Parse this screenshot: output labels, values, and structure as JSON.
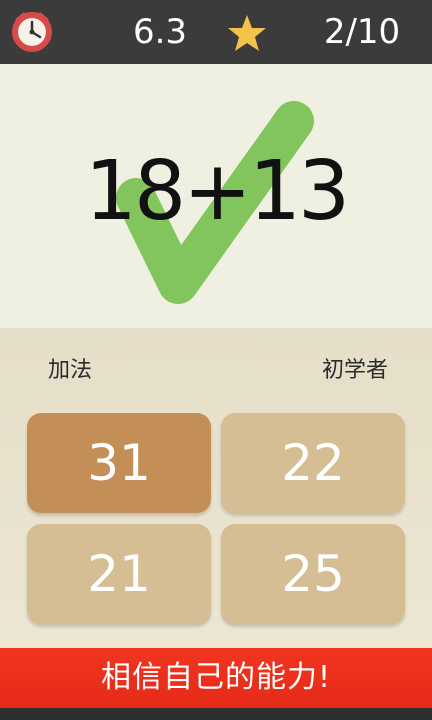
{
  "top_bar": {
    "timer_icon": "alarm-clock-icon",
    "time_value": "6.3",
    "score_icon": "star-icon",
    "progress": "2/10",
    "star_color": "#f2c24a",
    "clock_color": "#d64a4a"
  },
  "question": {
    "equation": "18+13",
    "feedback_icon": "check-icon",
    "feedback_color": "#82c55c"
  },
  "labels": {
    "mode": "加法",
    "level": "初学者"
  },
  "answers": [
    {
      "value": "31",
      "selected": true
    },
    {
      "value": "22",
      "selected": false
    },
    {
      "value": "21",
      "selected": false
    },
    {
      "value": "25",
      "selected": false
    }
  ],
  "slogan": "相信自己的能力!",
  "colors": {
    "bar_background": "#3b3b3b",
    "answer_default": "#d5bd94",
    "answer_selected": "#c38f57",
    "slogan_background": "#ed321d"
  }
}
